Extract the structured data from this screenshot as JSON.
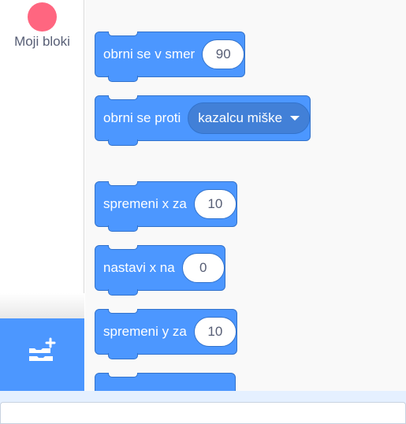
{
  "categories": {
    "my_blocks": {
      "label": "Moji bloki",
      "color": "#ff6680"
    }
  },
  "extension_button": {
    "icon": "add-extension-icon",
    "color": "#4c97ff"
  },
  "blocks": [
    {
      "label": "obrni se v smer",
      "value": "90"
    },
    {
      "label": "obrni se proti",
      "dropdown": "kazalcu miške"
    },
    {
      "label": "spremeni x za",
      "value": "10"
    },
    {
      "label": "nastavi x na",
      "value": "0"
    },
    {
      "label": "spremeni y za",
      "value": "10"
    }
  ],
  "colors": {
    "motion": "#4c97ff",
    "motion_border": "#3373cc"
  }
}
